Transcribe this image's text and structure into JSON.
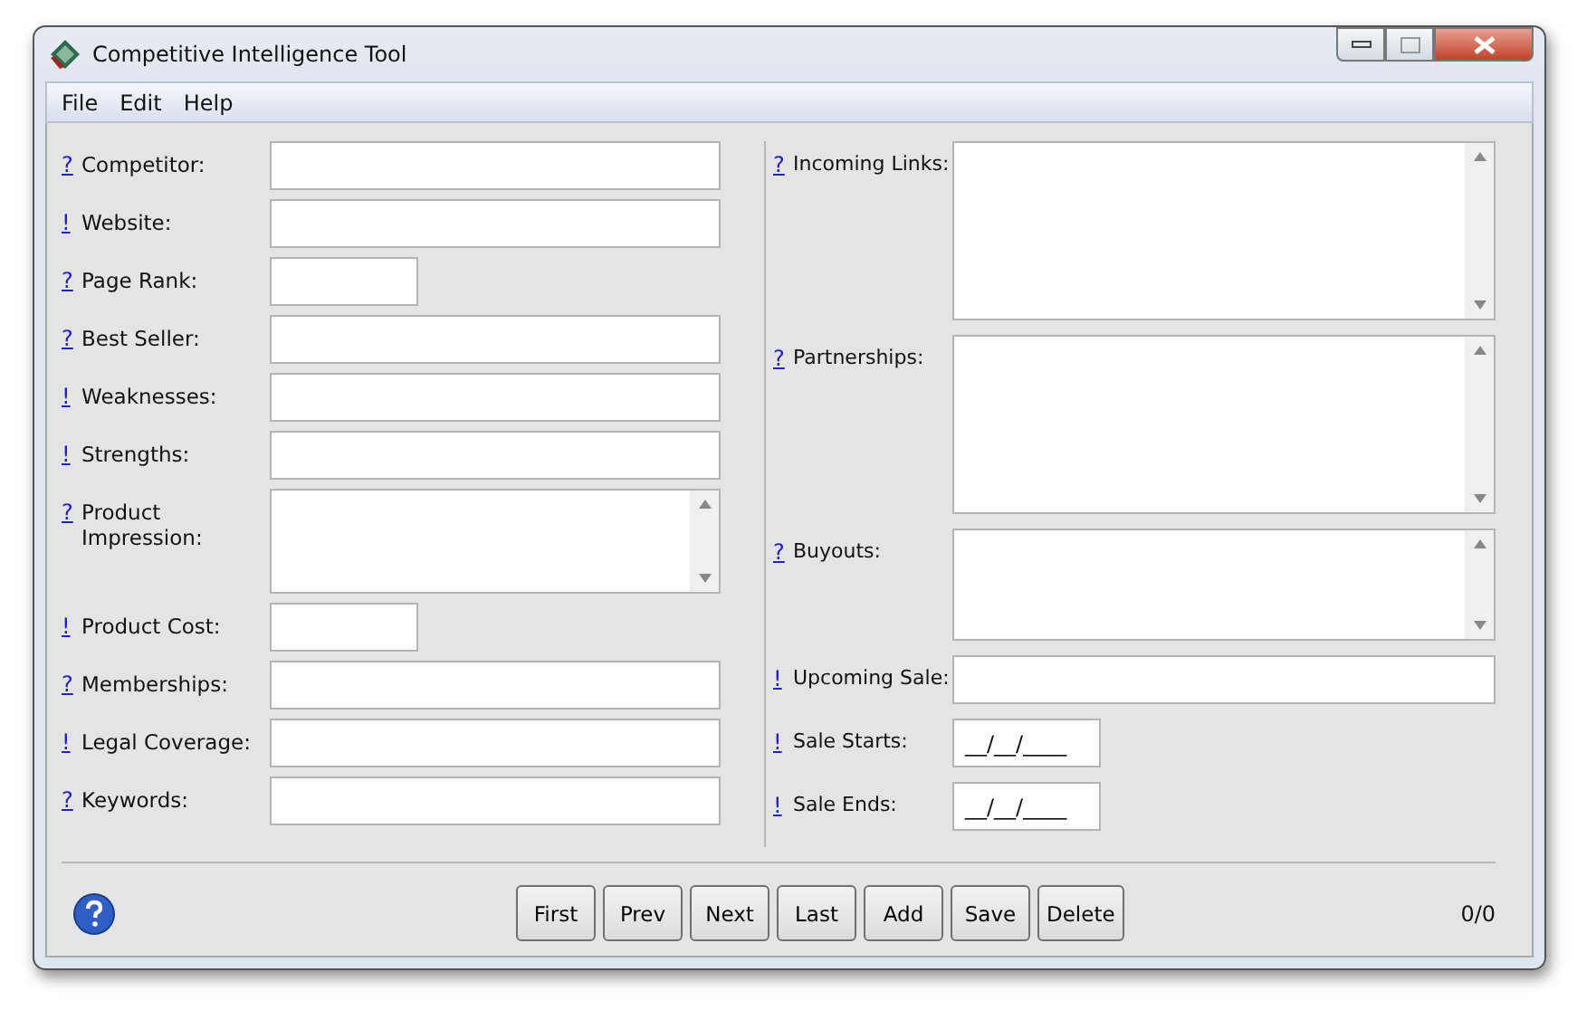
{
  "window": {
    "title": "Competitive Intelligence Tool"
  },
  "menu": [
    "File",
    "Edit",
    "Help"
  ],
  "left_fields": [
    {
      "marker": "?",
      "label": "Competitor:",
      "kind": "text"
    },
    {
      "marker": "!",
      "label": "Website:",
      "kind": "text"
    },
    {
      "marker": "?",
      "label": "Page Rank:",
      "kind": "short"
    },
    {
      "marker": "?",
      "label": "Best Seller:",
      "kind": "text"
    },
    {
      "marker": "!",
      "label": "Weaknesses:",
      "kind": "text"
    },
    {
      "marker": "!",
      "label": "Strengths:",
      "kind": "text"
    },
    {
      "marker": "?",
      "label": "Product Impression:",
      "kind": "memo"
    },
    {
      "marker": "!",
      "label": "Product Cost:",
      "kind": "short"
    },
    {
      "marker": "?",
      "label": "Memberships:",
      "kind": "text"
    },
    {
      "marker": "!",
      "label": "Legal Coverage:",
      "kind": "text"
    },
    {
      "marker": "?",
      "label": "Keywords:",
      "kind": "text"
    }
  ],
  "right_fields": [
    {
      "marker": "?",
      "label": "Incoming Links:",
      "kind": "memo_tall"
    },
    {
      "marker": "?",
      "label": "Partnerships:",
      "kind": "memo_tall"
    },
    {
      "marker": "?",
      "label": "Buyouts:",
      "kind": "memo"
    },
    {
      "marker": "!",
      "label": "Upcoming Sale:",
      "kind": "text"
    },
    {
      "marker": "!",
      "label": "Sale Starts:",
      "kind": "short",
      "value": "__/__/____"
    },
    {
      "marker": "!",
      "label": "Sale Ends:",
      "kind": "short",
      "value": "__/__/____"
    }
  ],
  "buttons": [
    "First",
    "Prev",
    "Next",
    "Last",
    "Add",
    "Save",
    "Delete"
  ],
  "record_count": "0/0"
}
